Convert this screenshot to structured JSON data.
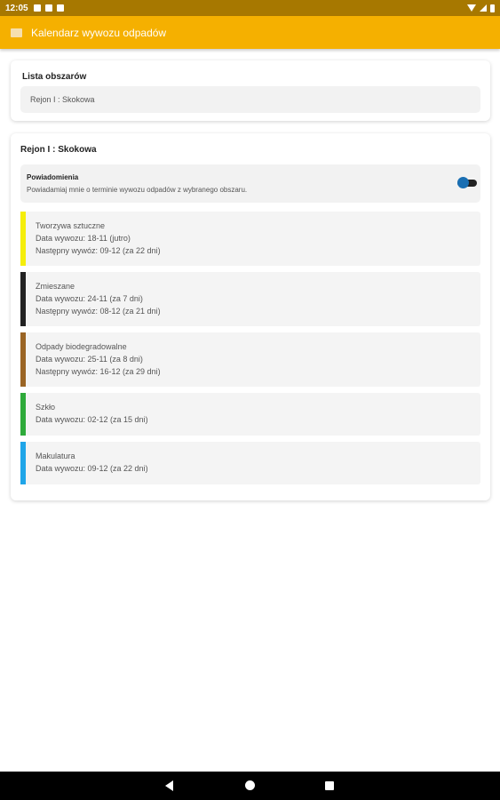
{
  "status": {
    "time": "12:05",
    "icons": [
      "notification-icon",
      "notification-icon",
      "notification-icon"
    ]
  },
  "app": {
    "title": "Kalendarz wywozu odpadów",
    "accent": "#f5b000"
  },
  "area_list": {
    "title": "Lista obszarów",
    "selected": "Rejon I : Skokowa"
  },
  "region": {
    "title": "Rejon I : Skokowa",
    "notifications": {
      "title": "Powiadomienia",
      "description": "Powiadamiaj mnie o terminie wywozu odpadów z wybranego obszaru.",
      "enabled": true
    },
    "waste": [
      {
        "name": "Tworzywa sztuczne",
        "color": "#f5ee0a",
        "line1": "Data wywozu: 18-11 (jutro)",
        "line2": "Następny wywóz: 09-12 (za 22 dni)"
      },
      {
        "name": "Zmieszane",
        "color": "#222222",
        "line1": "Data wywozu: 24-11 (za 7 dni)",
        "line2": "Następny wywóz: 08-12 (za 21 dni)"
      },
      {
        "name": "Odpady biodegradowalne",
        "color": "#9a6424",
        "line1": "Data wywozu: 25-11 (za 8 dni)",
        "line2": "Następny wywóz: 16-12 (za 29 dni)"
      },
      {
        "name": "Szkło",
        "color": "#2eaa3a",
        "line1": "Data wywozu: 02-12 (za 15 dni)",
        "line2": ""
      },
      {
        "name": "Makulatura",
        "color": "#1fa5e8",
        "line1": "Data wywozu: 09-12 (za 22 dni)",
        "line2": ""
      }
    ]
  }
}
